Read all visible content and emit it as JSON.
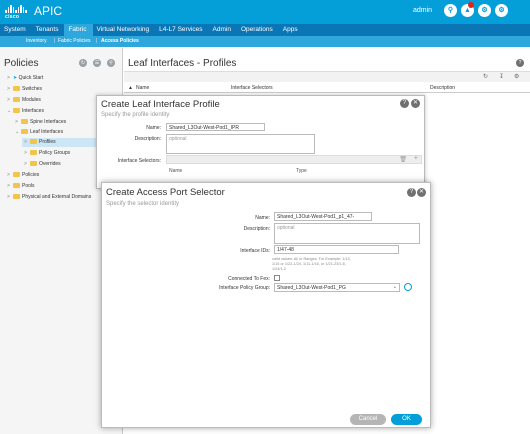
{
  "header": {
    "brand": "cisco",
    "app_title": "APIC",
    "user": "admin",
    "icons": [
      "search-icon",
      "alerts-icon",
      "tools-icon",
      "settings-icon"
    ],
    "accent": "#049fd9"
  },
  "main_tabs": [
    "System",
    "Tenants",
    "Fabric",
    "Virtual Networking",
    "L4-L7 Services",
    "Admin",
    "Operations",
    "Apps"
  ],
  "active_tab": "Fabric",
  "sub_tabs": [
    "Inventory",
    "Fabric Policies",
    "Access Policies"
  ],
  "sidebar": {
    "title": "Policies",
    "items": [
      "Quick Start",
      "Switches",
      "Modules",
      "Interfaces",
      "Spine Interfaces",
      "Leaf Interfaces",
      "Profiles",
      "Policy Groups",
      "Overrides",
      "Policies",
      "Pools",
      "Physical and External Domains"
    ],
    "selected": "Profiles"
  },
  "content": {
    "title": "Leaf Interfaces - Profiles",
    "columns": [
      "Name",
      "Interface Selectors",
      "Description"
    ]
  },
  "dialog_profile": {
    "title": "Create Leaf Interface Profile",
    "subtitle": "Specify the profile identity",
    "name_label": "Name:",
    "name_value": "Shared_L3Out-West-Pod1_IPR",
    "description_label": "Description:",
    "description_placeholder": "optional",
    "selectors_label": "Interface Selectors:",
    "selector_columns": [
      "Name",
      "Type"
    ]
  },
  "dialog_selector": {
    "title": "Create Access Port Selector",
    "subtitle": "Specify the selector identity",
    "name_label": "Name:",
    "name_value": "Shared_L3Out-West-Pod1_p1_47-",
    "description_label": "Description:",
    "description_placeholder": "optional",
    "interface_ids_label": "Interface IDs:",
    "interface_ids_value": "1/47-48",
    "interface_ids_hint": "valid values: All or Ranges. For Example: 1/13, 1/15 or 1/22-1/24, 1/11-1/16, or 1/21-23/1-6, 1/24/1-2",
    "connected_to_fex_label": "Connected To Fex:",
    "connected_to_fex_checked": false,
    "policy_group_label": "Interface Policy Group:",
    "policy_group_value": "Shared_L3Out-West-Pod1_PG",
    "cancel_label": "Cancel",
    "ok_label": "OK"
  }
}
